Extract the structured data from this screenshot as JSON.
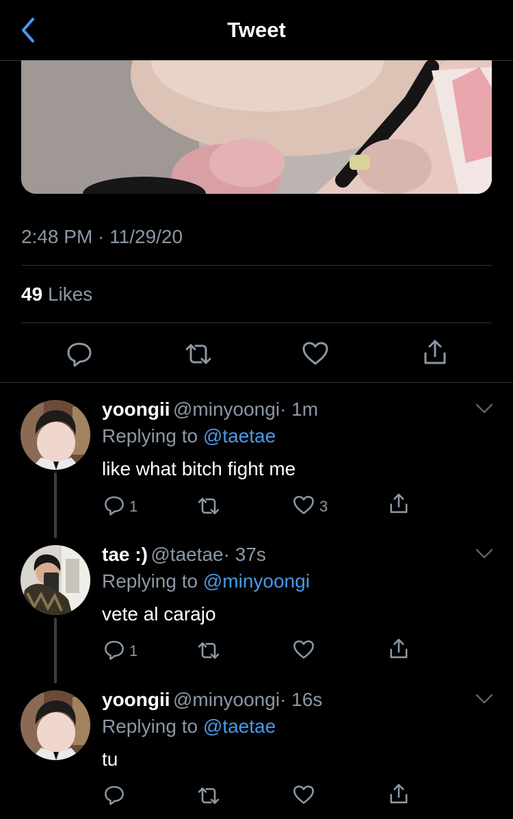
{
  "header": {
    "title": "Tweet"
  },
  "tweet": {
    "timestamp": "2:48 PM · 11/29/20",
    "likes_count": "49",
    "likes_label": "Likes"
  },
  "replies": [
    {
      "name": "yoongii",
      "handle": "@minyoongi",
      "time": "· 1m",
      "replying_prefix": "Replying to",
      "replying_to": "@taetae",
      "text": "like what bitch fight me",
      "reply_count": "1",
      "retweet_count": "",
      "like_count": "3"
    },
    {
      "name": "tae :)",
      "handle": "@taetae",
      "time": "· 37s",
      "replying_prefix": "Replying to",
      "replying_to": "@minyoongi",
      "text": "vete al carajo",
      "reply_count": "1",
      "retweet_count": "",
      "like_count": ""
    },
    {
      "name": "yoongii",
      "handle": "@minyoongi",
      "time": "· 16s",
      "replying_prefix": "Replying to",
      "replying_to": "@taetae",
      "text": "tu",
      "reply_count": "",
      "retweet_count": "",
      "like_count": ""
    }
  ],
  "colors": {
    "background": "#000000",
    "secondary_text": "#8b98a5",
    "link_blue": "#4a99e9",
    "back_arrow": "#4a99e9",
    "divider": "#2f3336"
  }
}
